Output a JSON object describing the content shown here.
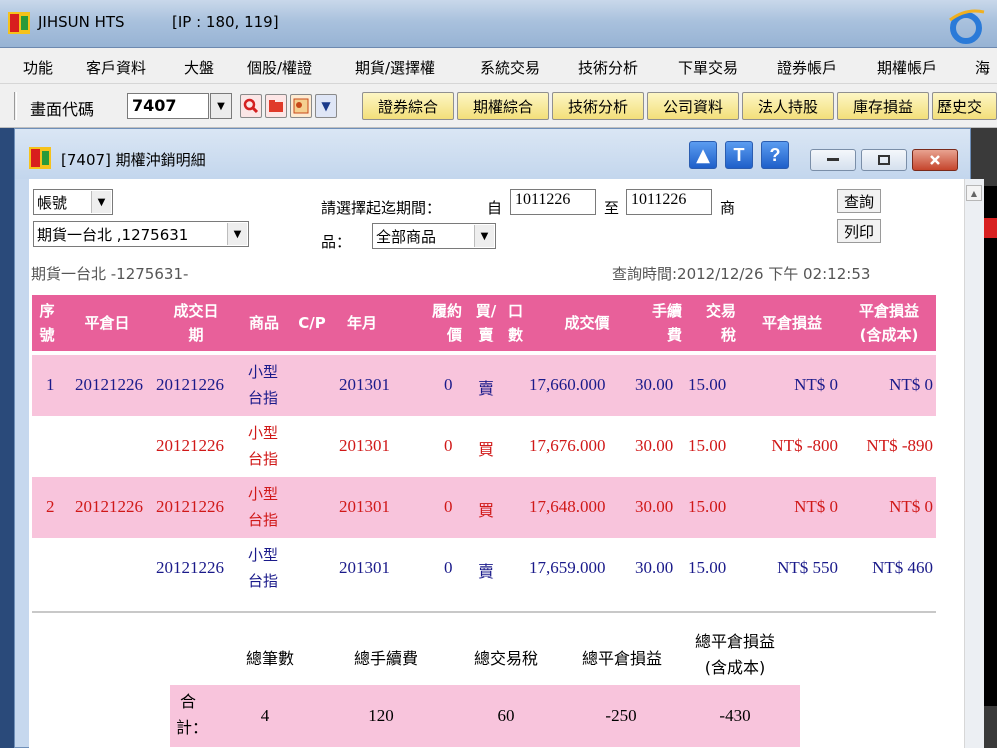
{
  "app": {
    "title": "JIHSUN HTS",
    "ip": "[IP : 180, 119]"
  },
  "menu": [
    "功能",
    "客戶資料",
    "大盤",
    "個股/權證",
    "期貨/選擇權",
    "系統交易",
    "技術分析",
    "下單交易",
    "證券帳戶",
    "期權帳戶",
    "海"
  ],
  "toolbar": {
    "code_label": "畫面代碼",
    "code_value": "7407",
    "buttons": [
      "證券綜合",
      "期權綜合",
      "技術分析",
      "公司資料",
      "法人持股",
      "庫存損益",
      "歷史交"
    ]
  },
  "window": {
    "title": "[7407] 期權沖銷明細",
    "up_btn": "▲",
    "t_btn": "T",
    "help_btn": "?"
  },
  "filters": {
    "account_label": "帳號",
    "account_value": "期貨一台北 ,1275631",
    "period_prompt": "請選擇起迄期間：",
    "from_label": "自",
    "from_value": "1011226",
    "to_label": "至",
    "to_value": "1011226",
    "product_label_a": "商",
    "product_label_b": "品：",
    "product_value": "全部商品",
    "query_btn": "查詢",
    "print_btn": "列印",
    "account_info": "期貨一台北 -1275631-",
    "query_time": "查詢時間:2012/12/26 下午 02:12:53"
  },
  "table": {
    "headers": {
      "seq": [
        "序",
        "號"
      ],
      "close_date": "平倉日",
      "trade_date": [
        "成交日",
        "期"
      ],
      "product": "商品",
      "cp": "C/P",
      "ym": "年月",
      "strike": [
        "履約",
        "價"
      ],
      "bs": [
        "買/",
        "賣"
      ],
      "qty": [
        "口",
        "數"
      ],
      "price": "成交價",
      "fee": [
        "手續",
        "費"
      ],
      "tax": [
        "交易",
        "稅"
      ],
      "pnl": "平倉損益",
      "pnl_cost": [
        "平倉損益",
        "(含成本)"
      ]
    },
    "rows": [
      {
        "seq": "1",
        "close_date": "20121226",
        "trade_date": "20121226",
        "product": [
          "小型",
          "台指"
        ],
        "ym": "201301",
        "strike": "0",
        "bs": "賣",
        "price": "17,660.000",
        "fee": "30.00",
        "tax": "15.00",
        "pnl": "NT$ 0",
        "pnl_cost": "NT$ 0"
      },
      {
        "seq": "",
        "close_date": "",
        "trade_date": "20121226",
        "product": [
          "小型",
          "台指"
        ],
        "ym": "201301",
        "strike": "0",
        "bs": "買",
        "price": "17,676.000",
        "fee": "30.00",
        "tax": "15.00",
        "pnl": "NT$ -800",
        "pnl_cost": "NT$ -890"
      },
      {
        "seq": "2",
        "close_date": "20121226",
        "trade_date": "20121226",
        "product": [
          "小型",
          "台指"
        ],
        "ym": "201301",
        "strike": "0",
        "bs": "買",
        "price": "17,648.000",
        "fee": "30.00",
        "tax": "15.00",
        "pnl": "NT$ 0",
        "pnl_cost": "NT$ 0"
      },
      {
        "seq": "",
        "close_date": "",
        "trade_date": "20121226",
        "product": [
          "小型",
          "台指"
        ],
        "ym": "201301",
        "strike": "0",
        "bs": "賣",
        "price": "17,659.000",
        "fee": "30.00",
        "tax": "15.00",
        "pnl": "NT$ 550",
        "pnl_cost": "NT$ 460"
      }
    ]
  },
  "summary": {
    "headers": {
      "count": "總筆數",
      "fee": "總手續費",
      "tax": "總交易稅",
      "pnl": "總平倉損益",
      "pnl_cost": [
        "總平倉損益",
        "(含成本)"
      ]
    },
    "label": [
      "合",
      "計："
    ],
    "values": {
      "count": "4",
      "fee": "120",
      "tax": "60",
      "pnl": "-250",
      "pnl_cost": "-430"
    }
  },
  "colors": {
    "header_pink": "#e8609a",
    "row_pink": "#f8c4dc",
    "text_blue": "#1a1a8a",
    "text_red": "#d01818"
  }
}
